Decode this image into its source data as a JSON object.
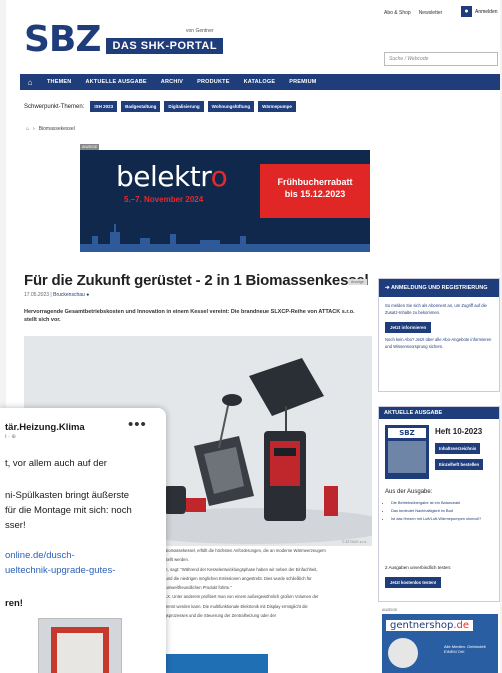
{
  "header": {
    "logo": "SBZ",
    "portal_label": "DAS SHK-PORTAL",
    "publisher": "von Gentner",
    "toplinks": [
      "Abo & Shop",
      "Newsletter"
    ],
    "account_label": "Anmelden",
    "search_placeholder": "Suche / Webcode"
  },
  "nav": {
    "items": [
      "THEMEN",
      "AKTUELLE AUSGABE",
      "ARCHIV",
      "PRODUKTE",
      "KATALOGE",
      "PREMIUM"
    ]
  },
  "topics": {
    "label": "Schwerpunkt-Themen:",
    "items": [
      "ISH 2023",
      "Badgestaltung",
      "Digitalisierung",
      "Wohnungslüftung",
      "Wärmepumpe"
    ]
  },
  "breadcrumb": {
    "current": "Biomassekessel"
  },
  "banner": {
    "ad_tag": "ANZEIGE",
    "brand_a": "belektr",
    "brand_b": "o",
    "dates": "5.–7. November 2024",
    "promo_line1": "Frühbucherrabatt",
    "promo_line2": "bis 15.12.2023"
  },
  "article": {
    "title": "Für die Zukunft gerüstet - 2 in 1 Biomassenkessel",
    "ad_label": "Anzeige",
    "date": "17.05.2023",
    "category": "Bruckenschau",
    "lead": "Hervorragende Gesamtbetriebskosten und Innovation in einem Kessel vereint: Die brandneue SLXCP-Reihe von ATTACK s.r.o. stellt sich vor.",
    "photo_credit": "© ATTACK s.r.o.",
    "body": [
      "r Biomassekessel, erfüllt die höchsten Anforderungen, die an moderne Wärmeerzeugern",
      "estellt werden.",
      "CK, sagt: \"Während der Kesselentwicklungsphase haben wir neben der Einfachheit,",
      "n und die niedrigen möglichen Emissionen angestrebt. Dies wurde schließlich für",
      "d umweltfreundlichen Produkt führte.\"",
      "SLX. Unter anderem profitiert man von einem außergewöhnlich großen Volumen der",
      "rbrennt werden kann. Die multifunktionale Elektronik mit Display ermöglicht die",
      "ngsprozesses und die Steuerung der Zentralheizung oder der"
    ]
  },
  "sidebar": {
    "login": {
      "heading": "ANMELDUNG UND REGISTRIERUNG",
      "text": "So melden Sie sich als Abonnent an, um Zugriff auf die Zusatz-Inhalte zu bekommen.",
      "button": "Jetzt informieren",
      "text2": "Noch kein Abo? Jetzt über alle Abo-Angebote informieren und Wissensvorsprung sichern."
    },
    "issue": {
      "heading": "AKTUELLE AUSGABE",
      "cover_logo": "SBZ",
      "title": "Heft 10-2023",
      "button1": "Inhaltsverzeichnis",
      "button2": "Einzelheft bestellen",
      "from_label": "Aus der Ausgabe:",
      "articles": [
        "Die Betriebsübergabe ist ein Balanceakt",
        "Das bedeutet Nachhaltigkeit im Bad",
        "Ist das Heizen mit Luft/Luft-Wärmepumpen sinnvoll?"
      ],
      "free_text": "2 Ausgaben unverbindlich testen:",
      "free_button": "Jetzt kostenlos testen!"
    },
    "ad": {
      "tag": "ANZEIGE",
      "brand_a": "gentnershop",
      "brand_b": ".de",
      "text": "Alle Medien. Gebündelt EINEM Ort!"
    }
  },
  "post": {
    "name": "tär.Heizung.Klima",
    "meta": "t · ⊕",
    "lines": [
      "t, vor allem auch auf der",
      "ni-Spülkasten bringt äußerste",
      "für die Montage mit sich: noch",
      "sser!",
      "online.de/dusch-",
      "ueltechnik-upgrade-gutes-",
      "ren!"
    ],
    "more_label": "•••"
  }
}
